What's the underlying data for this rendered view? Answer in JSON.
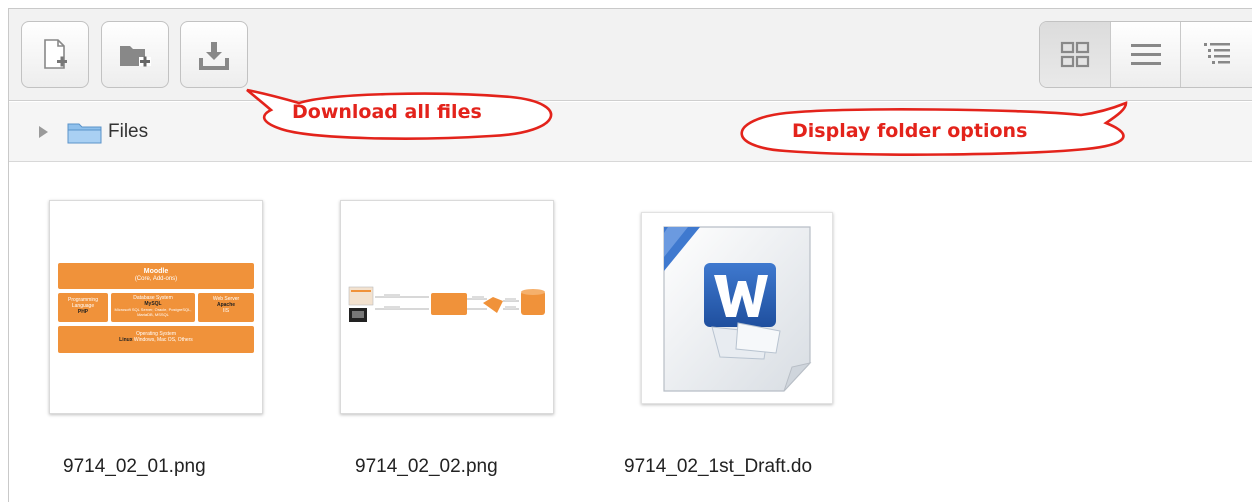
{
  "toolbar": {
    "buttons": [
      {
        "name": "create-file-button",
        "icon": "new-file-icon"
      },
      {
        "name": "create-folder-button",
        "icon": "new-folder-icon"
      },
      {
        "name": "download-all-button",
        "icon": "download-icon"
      }
    ],
    "view_modes": [
      {
        "name": "view-icons-button",
        "icon": "grid-view-icon",
        "active": true
      },
      {
        "name": "view-list-button",
        "icon": "list-view-icon",
        "active": false
      },
      {
        "name": "view-tree-button",
        "icon": "tree-view-icon",
        "active": false
      }
    ]
  },
  "breadcrumb": {
    "label": "Files"
  },
  "annotations": {
    "download": "Download all files",
    "display": "Display folder options",
    "color": "#e3231b"
  },
  "files": [
    {
      "name": "9714_02_01.png",
      "thumbnail": {
        "top": "Moodle",
        "top_sub": "(Core, Add-ons)",
        "left": "Programming Language",
        "left_tag": "PHP",
        "mid": "Database System",
        "mid_tag": "MySQL",
        "mid_sub": "Microsoft SQL Server, Oracle, PostgreSQL, MariaDB, MSSQL",
        "right": "Web Server",
        "right_tag": "Apache",
        "right_sub": "IIS",
        "bottom": "Operating System",
        "bottom_tag": "Linux",
        "bottom_sub": "Windows, Mac OS, Others"
      }
    },
    {
      "name": "9714_02_02.png"
    },
    {
      "name": "9714_02_1st_Draft.do"
    }
  ],
  "colors": {
    "accent_orange": "#f0923a",
    "word_blue": "#2a5db0"
  }
}
